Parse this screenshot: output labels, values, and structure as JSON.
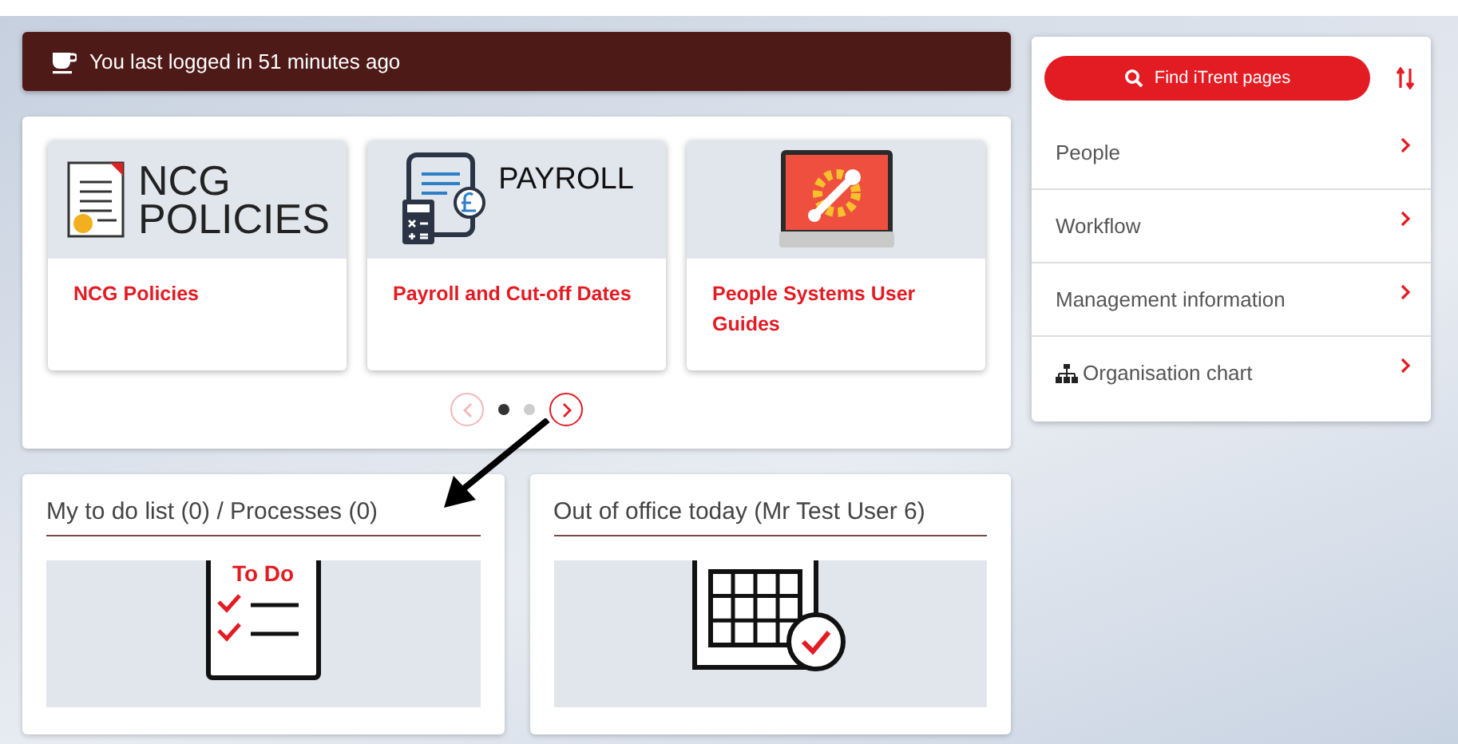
{
  "banner": {
    "text": "You last logged in 51 minutes ago"
  },
  "carousel": {
    "tiles": [
      {
        "kind": "policies",
        "image_text": [
          "NCG",
          "POLICIES"
        ],
        "title": "NCG Policies"
      },
      {
        "kind": "payroll",
        "image_text": [
          "PAYROLL"
        ],
        "title": "Payroll and Cut-off Dates"
      },
      {
        "kind": "systems",
        "title": "People Systems User Guides"
      }
    ],
    "prev_disabled": true,
    "pages": [
      {
        "selected": true
      },
      {
        "selected": false
      }
    ]
  },
  "widgets": [
    {
      "kind": "todo",
      "title": "My to do list (0) / Processes (0)",
      "image_text": "To Do"
    },
    {
      "kind": "calendar",
      "title": "Out of office today (Mr Test User 6)"
    }
  ],
  "sidebar": {
    "search_button": "Find iTrent pages",
    "items": [
      {
        "label": "People",
        "kind": "plain"
      },
      {
        "label": "Workflow",
        "kind": "plain"
      },
      {
        "label": "Management information",
        "kind": "plain"
      },
      {
        "label": "Organisation chart",
        "kind": "org"
      }
    ]
  }
}
